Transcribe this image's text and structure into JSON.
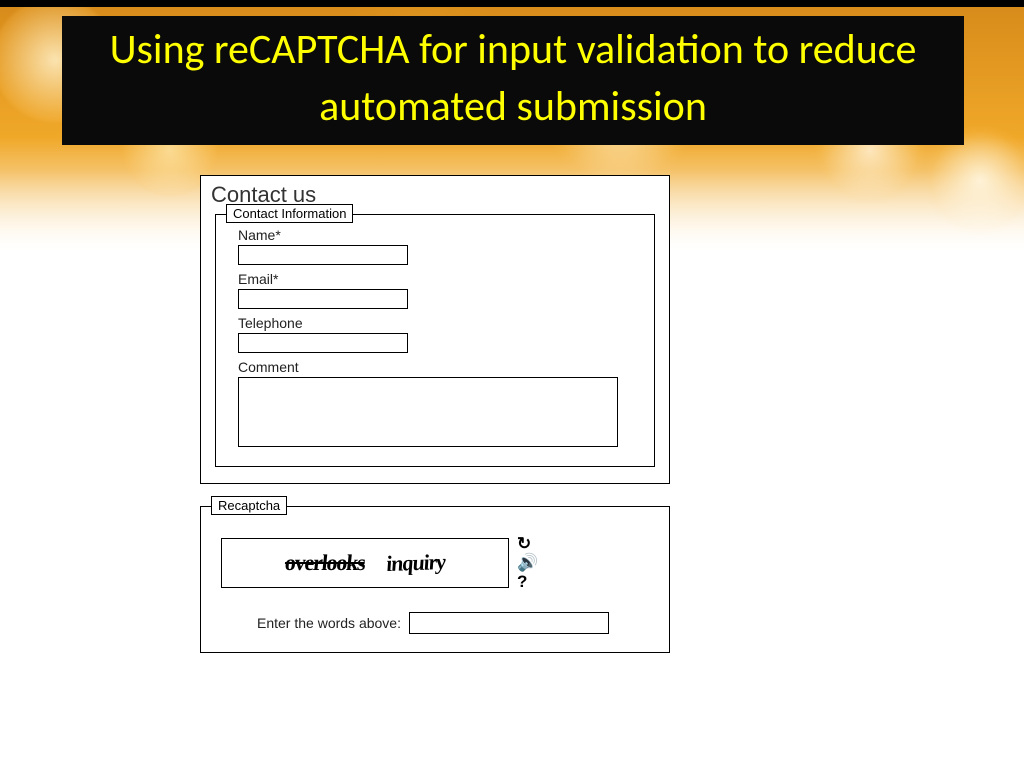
{
  "slide": {
    "title": "Using reCAPTCHA for input validation to reduce automated submission"
  },
  "contact_panel": {
    "heading": "Contact us",
    "fieldset_legend": "Contact Information",
    "fields": {
      "name": {
        "label": "Name*",
        "value": ""
      },
      "email": {
        "label": "Email*",
        "value": ""
      },
      "telephone": {
        "label": "Telephone",
        "value": ""
      },
      "comment": {
        "label": "Comment",
        "value": ""
      }
    }
  },
  "recaptcha_panel": {
    "legend": "Recaptcha",
    "challenge_words": [
      "overlooks",
      "inquiry"
    ],
    "controls": {
      "refresh": "↻",
      "audio": "🔊",
      "help": "?"
    },
    "answer_label": "Enter the words above:",
    "answer_value": ""
  }
}
